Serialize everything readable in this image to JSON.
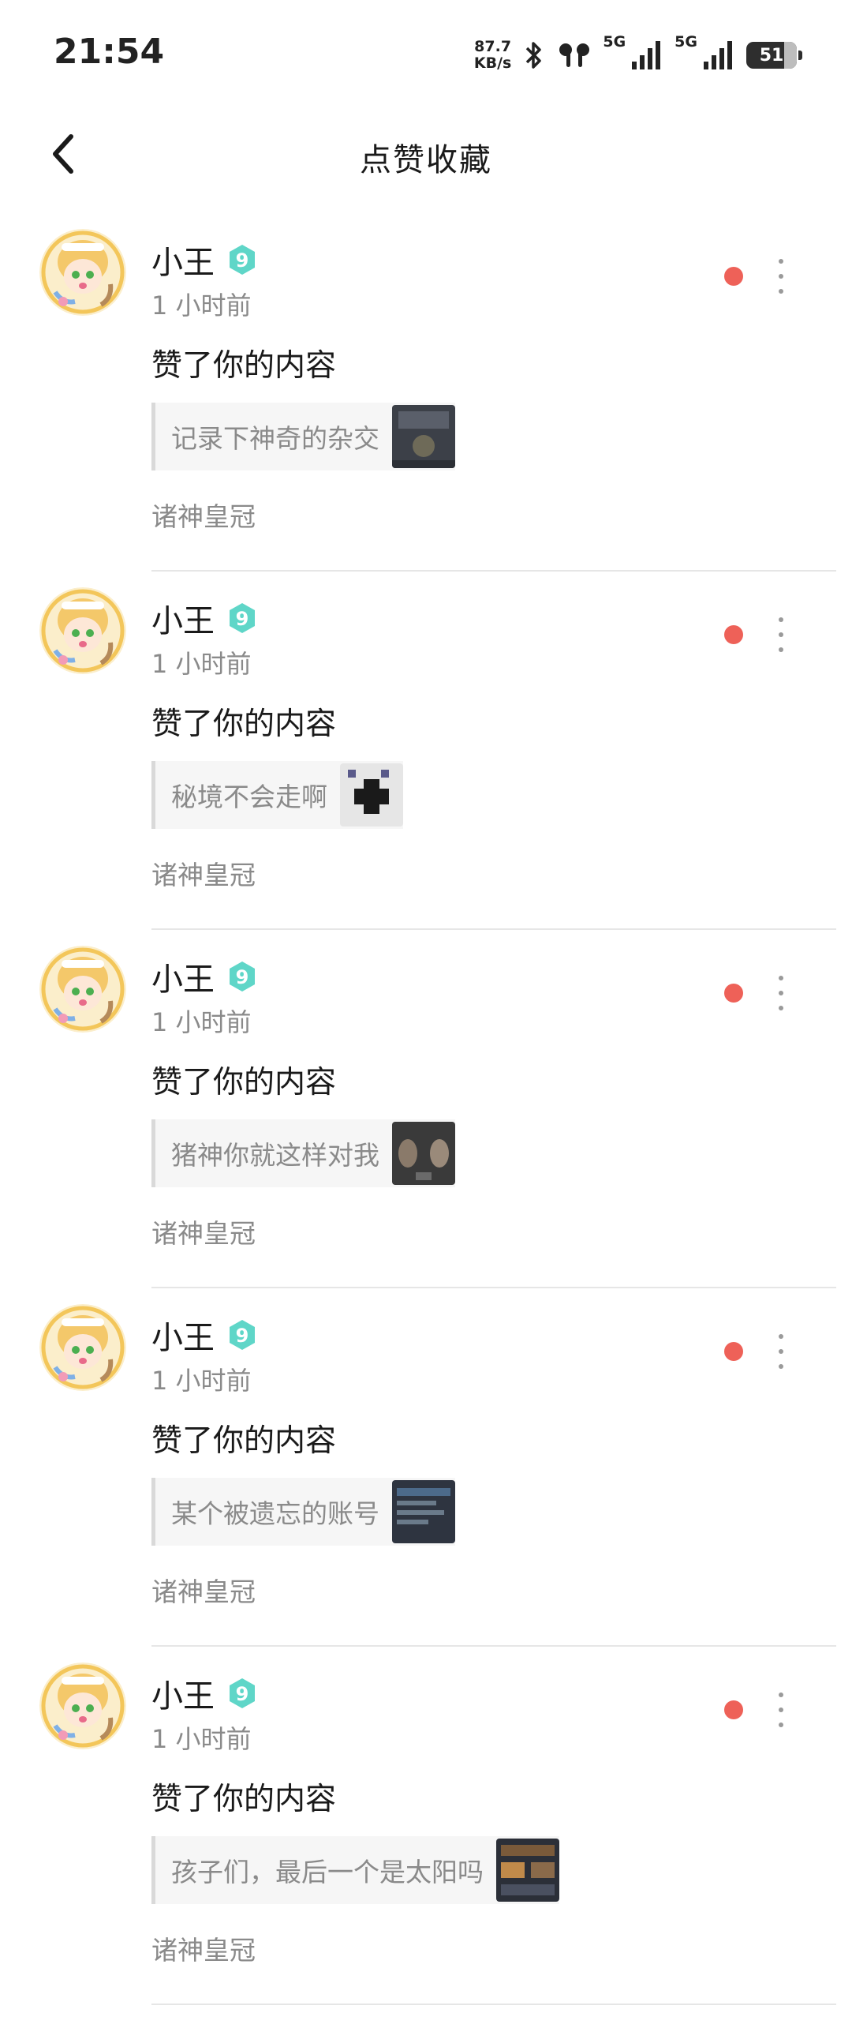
{
  "status_bar": {
    "time": "21:54",
    "net_speed_value": "87.7",
    "net_speed_unit": "KB/s",
    "signal1_label": "5G",
    "signal2_label": "5G",
    "battery_level": "51",
    "icons": [
      "bluetooth-icon",
      "earbuds-icon",
      "signal-icon",
      "signal-icon",
      "battery-icon"
    ]
  },
  "header": {
    "title": "点赞收藏",
    "back_icon": "chevron-left-icon"
  },
  "colors": {
    "unread_dot": "#ee6158",
    "level_badge": "#5fd6c8"
  },
  "notifications": [
    {
      "username": "小王",
      "level": "9",
      "time_ago": "1 小时前",
      "action": "赞了你的内容",
      "post_title": "记录下神奇的杂交",
      "game": "诸神皇冠"
    },
    {
      "username": "小王",
      "level": "9",
      "time_ago": "1 小时前",
      "action": "赞了你的内容",
      "post_title": "秘境不会走啊",
      "game": "诸神皇冠"
    },
    {
      "username": "小王",
      "level": "9",
      "time_ago": "1 小时前",
      "action": "赞了你的内容",
      "post_title": "猪神你就这样对我",
      "game": "诸神皇冠"
    },
    {
      "username": "小王",
      "level": "9",
      "time_ago": "1 小时前",
      "action": "赞了你的内容",
      "post_title": "某个被遗忘的账号",
      "game": "诸神皇冠"
    },
    {
      "username": "小王",
      "level": "9",
      "time_ago": "1 小时前",
      "action": "赞了你的内容",
      "post_title": "孩子们，最后一个是太阳吗",
      "game": "诸神皇冠"
    }
  ]
}
